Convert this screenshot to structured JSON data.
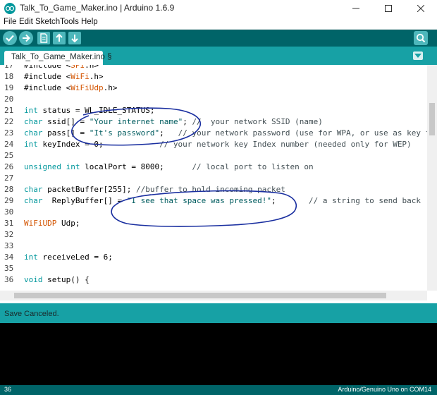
{
  "window": {
    "title": "Talk_To_Game_Maker.ino | Arduino 1.6.9"
  },
  "menu": [
    "File",
    "Edit",
    "Sketch",
    "Tools",
    "Help"
  ],
  "toolbar": {
    "buttons": [
      "verify-icon",
      "upload-icon",
      "new-icon",
      "open-icon",
      "save-icon"
    ],
    "serial_monitor": "serial-monitor-icon"
  },
  "tab": {
    "label": "Talk_To_Game_Maker.ino §"
  },
  "editor": {
    "lines": [
      {
        "num": "17",
        "html": "#include &lt;<span class='lib'>SPI</span>.h&gt;"
      },
      {
        "num": "18",
        "html": "#include &lt;<span class='lib'>WiFi</span>.h&gt;"
      },
      {
        "num": "19",
        "html": "#include &lt;<span class='lib'>WiFiUdp</span>.h&gt;"
      },
      {
        "num": "20",
        "html": ""
      },
      {
        "num": "21",
        "html": "<span class='kw'>int</span> status = WL_IDLE_STATUS;"
      },
      {
        "num": "22",
        "html": "<span class='kw'>char</span> ssid[] = <span class='str'>\"Your internet name\"</span>; <span class='cm'>//  your network SSID (name)</span>"
      },
      {
        "num": "23",
        "html": "<span class='kw'>char</span> pass[] = <span class='str'>\"It's password\"</span>;   <span class='cm'>// your network password (use for WPA, or use as key f</span>"
      },
      {
        "num": "24",
        "html": "<span class='kw'>int</span> keyIndex = 0;            <span class='cm'>// your network key Index number (needed only for WEP)</span>"
      },
      {
        "num": "25",
        "html": ""
      },
      {
        "num": "26",
        "html": "<span class='kw'>unsigned</span> <span class='kw'>int</span> localPort = 8000;      <span class='cm'>// local port to listen on</span>"
      },
      {
        "num": "27",
        "html": ""
      },
      {
        "num": "28",
        "html": "<span class='kw'>char</span> packetBuffer[255]; <span class='cm'>//buffer to hold incoming packet</span>"
      },
      {
        "num": "29",
        "html": "<span class='kw'>char</span>  ReplyBuffer[] = <span class='str'>\"I see that space was pressed!\"</span>;       <span class='cm'>// a string to send back</span>"
      },
      {
        "num": "30",
        "html": ""
      },
      {
        "num": "31",
        "html": "<span class='tp'>WiFiUDP</span> Udp;"
      },
      {
        "num": "32",
        "html": ""
      },
      {
        "num": "33",
        "html": ""
      },
      {
        "num": "34",
        "html": "<span class='kw'>int</span> receiveLed = 6;"
      },
      {
        "num": "35",
        "html": ""
      },
      {
        "num": "36",
        "html": "<span class='kw'>void</span> setup() {"
      }
    ]
  },
  "status": {
    "message": "Save Canceled.",
    "line_number": "36",
    "board": "Arduino/Genuino Uno on COM14"
  },
  "colors": {
    "toolbar": "#006468",
    "tabstrip": "#17a1a5",
    "button": "#4db7bb",
    "ink": "#1a2fa0"
  }
}
